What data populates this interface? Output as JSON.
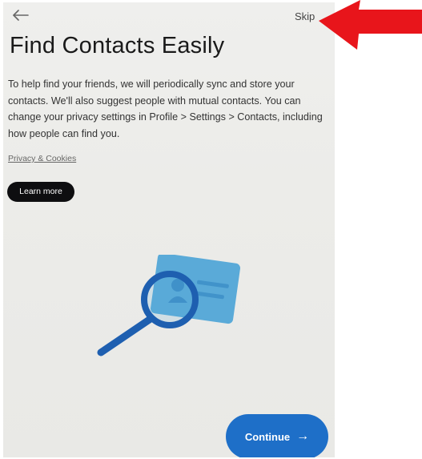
{
  "header": {
    "back_icon": "arrow-left-icon",
    "skip_label": "Skip"
  },
  "main": {
    "title": "Find Contacts Easily",
    "description": "To help find your friends, we will periodically sync and store your contacts. We'll also suggest people with mutual contacts. You can change your privacy settings in Profile > Settings > Contacts, including how people can find you.",
    "privacy_link": "Privacy & Cookies",
    "learn_more_label": "Learn more",
    "illustration_icon": "contact-card-magnifier-icon"
  },
  "footer": {
    "continue_label": "Continue",
    "continue_arrow": "→"
  },
  "colors": {
    "accent": "#1e6fc8",
    "card": "#5aaad8",
    "dark_button": "#0e0e10",
    "annotation_arrow": "#e8151b"
  }
}
